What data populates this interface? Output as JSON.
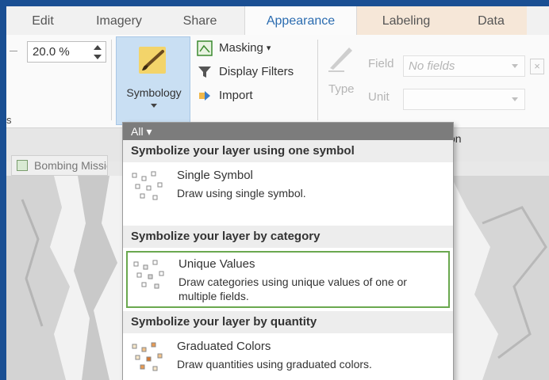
{
  "tabs": [
    "Edit",
    "Imagery",
    "Share",
    "Appearance",
    "Labeling",
    "Data"
  ],
  "ribbon": {
    "transparency_value": "20.0 %",
    "symbology_label": "Symbology",
    "masking_label": "Masking",
    "display_filters_label": "Display Filters",
    "import_label": "Import",
    "type_label": "Type",
    "field_label": "Field",
    "field_value": "No fields",
    "unit_label": "Unit",
    "close_glyph": "×",
    "group_left_fragment": "s",
    "group_right_fragment": "on"
  },
  "map": {
    "tab_label": "Bombing Missions"
  },
  "menu": {
    "filter_label": "All ▾",
    "sections": [
      {
        "header": "Symbolize your layer using one symbol",
        "items": [
          {
            "title": "Single Symbol",
            "desc": "Draw using single symbol.",
            "icon": "single-symbol-icon",
            "highlighted": false
          }
        ]
      },
      {
        "header": "Symbolize your layer by category",
        "items": [
          {
            "title": "Unique Values",
            "desc": "Draw categories using unique values of one or multiple fields.",
            "icon": "unique-values-icon",
            "highlighted": true
          }
        ]
      },
      {
        "header": "Symbolize your layer by quantity",
        "items": [
          {
            "title": "Graduated Colors",
            "desc": "Draw quantities using graduated colors.",
            "icon": "graduated-colors-icon",
            "highlighted": false
          }
        ]
      }
    ]
  },
  "colors": {
    "frame_border": "#1a4f93",
    "active_tab_text": "#2b6cb0",
    "highlight_border": "#6aa84f",
    "symbology_button": "#c9dff3",
    "menu_header": "#7c7c7c"
  }
}
